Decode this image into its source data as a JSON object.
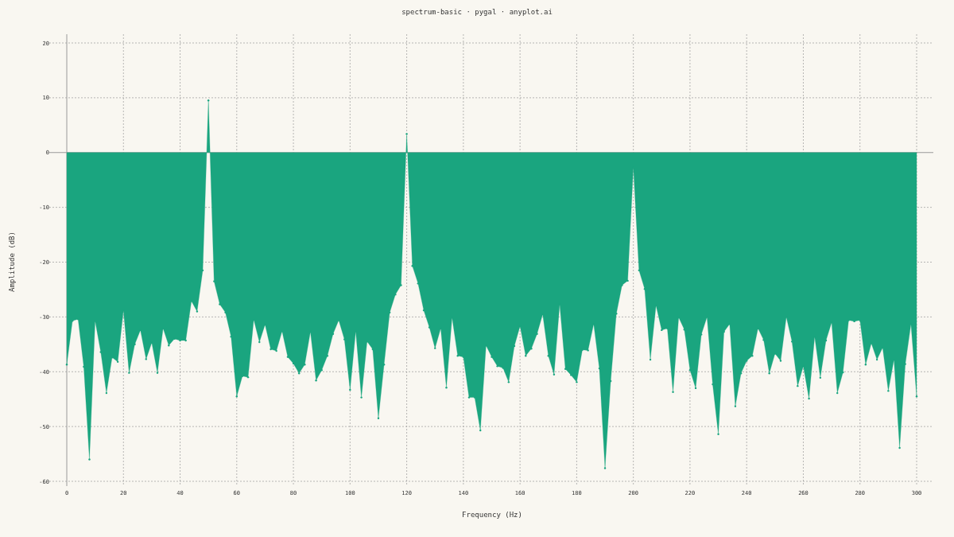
{
  "chart_data": {
    "type": "area",
    "title": "spectrum-basic · pygal · anyplot.ai",
    "xlabel": "Frequency (Hz)",
    "ylabel": "Amplitude (dB)",
    "x": [
      0,
      2,
      4,
      6,
      8,
      10,
      12,
      14,
      16,
      18,
      20,
      22,
      24,
      26,
      28,
      30,
      32,
      34,
      36,
      38,
      40,
      42,
      44,
      46,
      48,
      50,
      52,
      54,
      56,
      58,
      60,
      62,
      64,
      66,
      68,
      70,
      72,
      74,
      76,
      78,
      80,
      82,
      84,
      86,
      88,
      90,
      92,
      94,
      96,
      98,
      100,
      102,
      104,
      106,
      108,
      110,
      112,
      114,
      116,
      118,
      120,
      122,
      124,
      126,
      128,
      130,
      132,
      134,
      136,
      138,
      140,
      142,
      144,
      146,
      148,
      150,
      152,
      154,
      156,
      158,
      160,
      162,
      164,
      166,
      168,
      170,
      172,
      174,
      176,
      178,
      180,
      182,
      184,
      186,
      188,
      190,
      192,
      194,
      196,
      198,
      200,
      202,
      204,
      206,
      208,
      210,
      212,
      214,
      216,
      218,
      220,
      222,
      224,
      226,
      228,
      230,
      232,
      234,
      236,
      238,
      240,
      242,
      244,
      246,
      248,
      250,
      252,
      254,
      256,
      258,
      260,
      262,
      264,
      266,
      268,
      270,
      272,
      274,
      276,
      278,
      280,
      282,
      284,
      286,
      288,
      290,
      292,
      294,
      296,
      298,
      300
    ],
    "series": [
      {
        "color": "#1aa57f",
        "values": [
          -38.7,
          -30.7,
          -30.4,
          -39.1,
          -56.0,
          -30.7,
          -36.4,
          -43.9,
          -37.4,
          -38.2,
          -28.8,
          -40.2,
          -35.0,
          -32.4,
          -37.7,
          -34.7,
          -40.2,
          -32.1,
          -35.2,
          -34.0,
          -34.3,
          -34.3,
          -27.1,
          -29.0,
          -21.5,
          9.5,
          -23.5,
          -27.7,
          -29.2,
          -33.6,
          -44.5,
          -40.8,
          -41.0,
          -30.5,
          -34.6,
          -31.4,
          -35.9,
          -36.2,
          -32.6,
          -37.3,
          -38.5,
          -40.3,
          -38.7,
          -32.7,
          -41.6,
          -39.7,
          -37.1,
          -33.1,
          -30.6,
          -34.1,
          -43.3,
          -32.6,
          -44.7,
          -34.5,
          -35.9,
          -48.5,
          -38.7,
          -29.2,
          -25.9,
          -24.2,
          3.4,
          -20.7,
          -23.9,
          -28.8,
          -31.9,
          -35.7,
          -32.1,
          -42.9,
          -30.1,
          -37.1,
          -37.3,
          -44.7,
          -44.7,
          -50.7,
          -35.2,
          -37.3,
          -39.0,
          -39.3,
          -41.9,
          -35.3,
          -31.7,
          -37.1,
          -35.8,
          -33.1,
          -29.5,
          -37.1,
          -40.5,
          -27.7,
          -39.5,
          -40.6,
          -41.9,
          -36.0,
          -36.1,
          -31.3,
          -39.4,
          -57.6,
          -41.7,
          -29.4,
          -24.2,
          -23.4,
          -2.7,
          -21.5,
          -24.9,
          -37.8,
          -27.9,
          -32.4,
          -32.1,
          -43.7,
          -30.1,
          -32.3,
          -39.7,
          -43.0,
          -33.2,
          -30.0,
          -42.3,
          -51.4,
          -32.7,
          -31.3,
          -46.3,
          -40.3,
          -38.0,
          -37.1,
          -32.1,
          -34.2,
          -40.3,
          -36.7,
          -38.0,
          -30.0,
          -34.5,
          -42.6,
          -39.0,
          -44.9,
          -33.6,
          -41.1,
          -34.3,
          -31.0,
          -43.9,
          -40.1,
          -30.6,
          -30.8,
          -30.6,
          -38.7,
          -34.8,
          -37.8,
          -35.6,
          -43.5,
          -37.8,
          -53.9,
          -38.6,
          -31.3,
          -44.5
        ]
      }
    ],
    "xlim": [
      0,
      300
    ],
    "ylim": [
      -60,
      20
    ],
    "xticks": [
      0,
      20,
      40,
      60,
      80,
      100,
      120,
      140,
      160,
      180,
      200,
      220,
      240,
      260,
      280,
      300
    ],
    "yticks": [
      -60,
      -50,
      -40,
      -30,
      -20,
      -10,
      0,
      10,
      20
    ],
    "grid": true
  }
}
